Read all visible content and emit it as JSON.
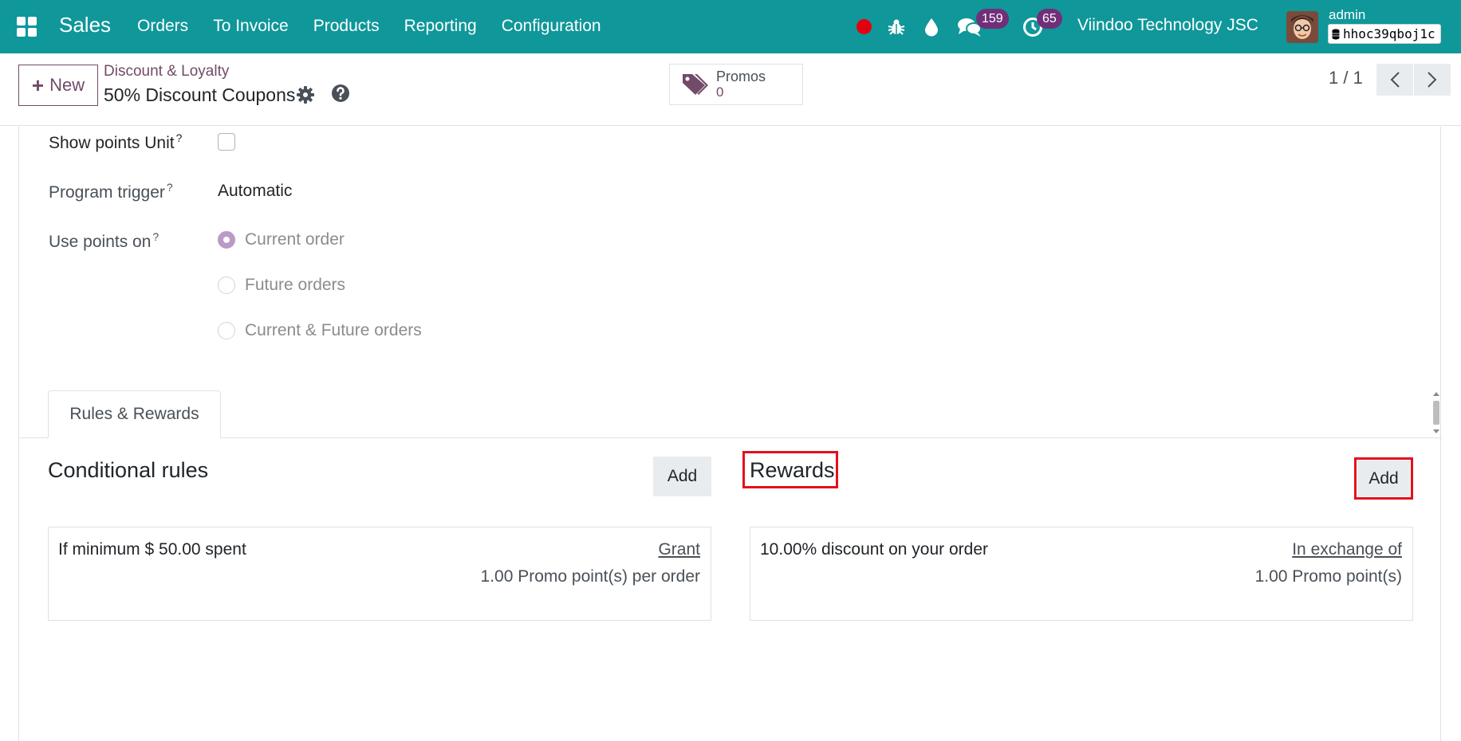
{
  "navbar": {
    "app_name": "Sales",
    "menu": [
      "Orders",
      "To Invoice",
      "Products",
      "Reporting",
      "Configuration"
    ],
    "messages_count": "159",
    "activities_count": "65",
    "company": "Viindoo Technology JSC",
    "user": "admin",
    "database": "hhoc39qboj1c",
    "icons": [
      "apps-grid-icon",
      "record-dot-icon",
      "bug-icon",
      "droplet-icon",
      "chat-icon",
      "clock-icon"
    ]
  },
  "control_panel": {
    "new_label": "New",
    "breadcrumb": "Discount & Loyalty",
    "record_title": "50% Discount Coupons",
    "smart_button": {
      "label": "Promos",
      "value": "0"
    },
    "pager": "1 / 1"
  },
  "form": {
    "show_points_unit": {
      "label": "Show points Unit",
      "help": "?",
      "checked": false
    },
    "program_trigger": {
      "label": "Program trigger",
      "help": "?",
      "value": "Automatic"
    },
    "use_points_on": {
      "label": "Use points on",
      "help": "?",
      "options": [
        {
          "label": "Current order",
          "checked": true
        },
        {
          "label": "Future orders",
          "checked": false
        },
        {
          "label": "Current & Future orders",
          "checked": false
        }
      ]
    },
    "tab_label": "Rules & Rewards"
  },
  "rules": {
    "title": "Conditional rules",
    "add_label": "Add",
    "items": [
      {
        "description": "If minimum $ 50.00 spent",
        "link": "Grant",
        "detail": "1.00 Promo point(s) per order"
      }
    ]
  },
  "rewards": {
    "title": "Rewards",
    "add_label": "Add",
    "items": [
      {
        "description": "10.00% discount on your order",
        "link": "In exchange of",
        "detail": "1.00 Promo point(s)"
      }
    ]
  },
  "colors": {
    "navbar": "#0f979a",
    "primary": "#714b67",
    "badge": "#712f79",
    "highlight": "#e3101e"
  }
}
